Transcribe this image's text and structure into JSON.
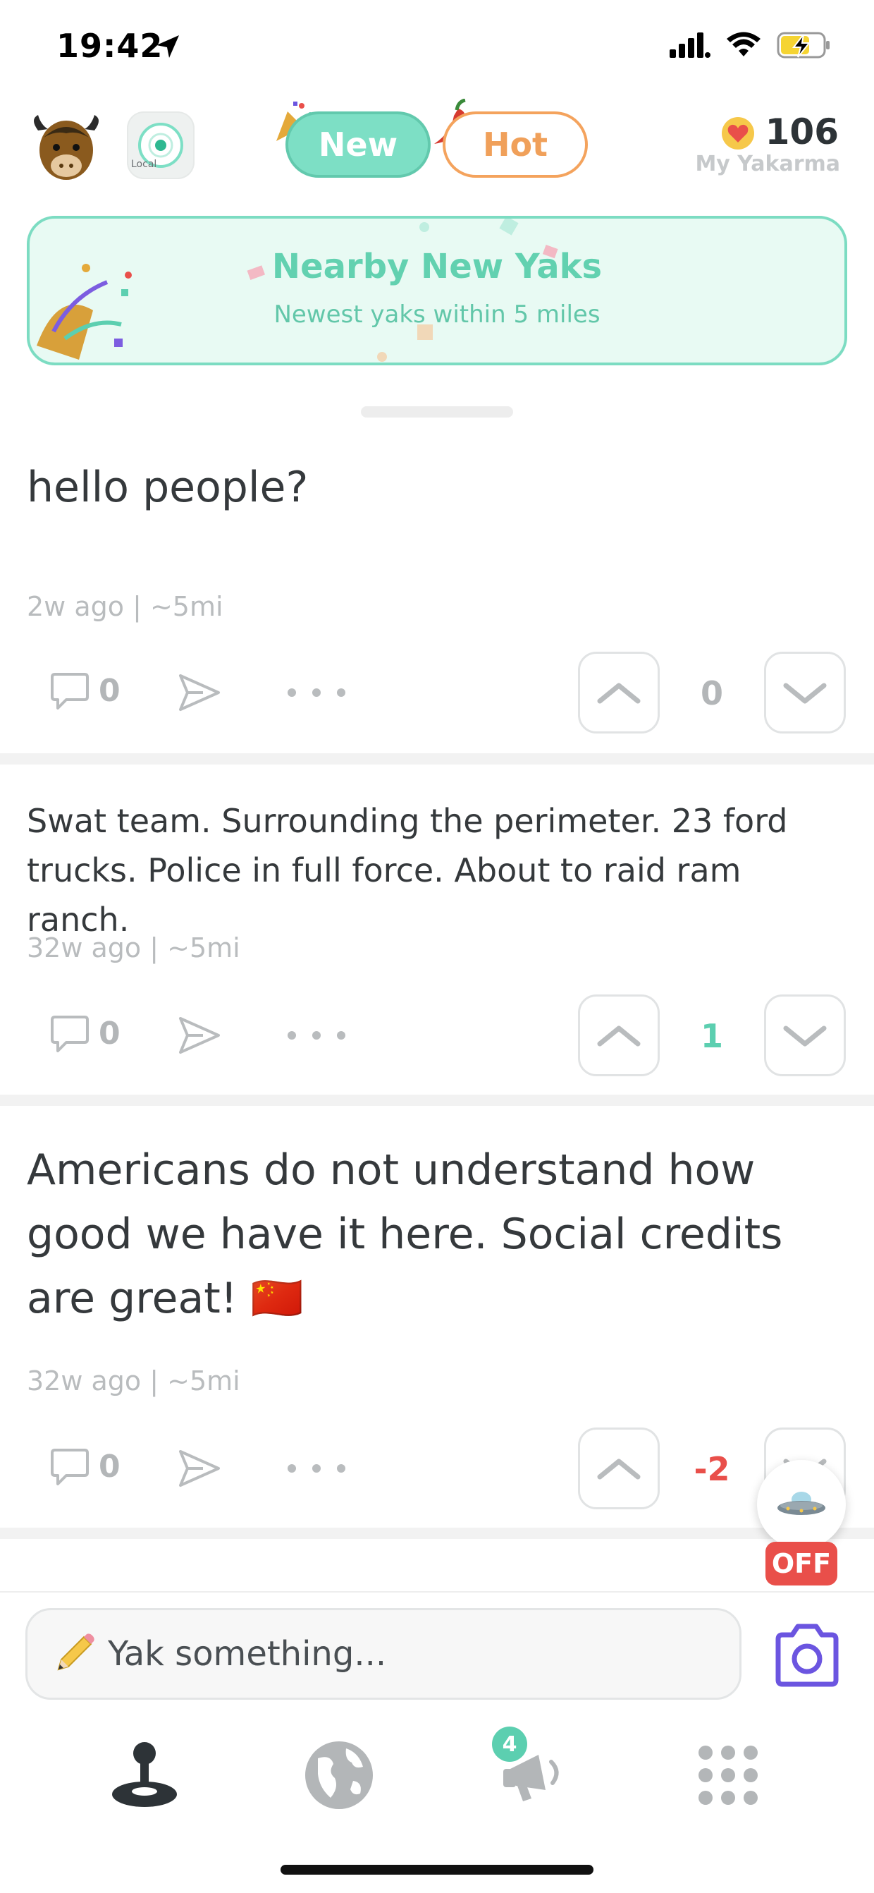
{
  "status_bar": {
    "time": "19:42"
  },
  "header": {
    "avatar_icon": "yak-avatar-icon",
    "local_label": "Local",
    "tabs": [
      {
        "label": "New",
        "active": true
      },
      {
        "label": "Hot",
        "active": false
      }
    ],
    "karma": {
      "value": "106",
      "label": "My Yakarma"
    }
  },
  "banner": {
    "title": "Nearby New Yaks",
    "subtitle": "Newest yaks within 5 miles"
  },
  "posts": [
    {
      "text": "hello people?",
      "meta": "2w ago | ~5mi",
      "comments": "0",
      "score": "0",
      "score_color": "#b3b6b8"
    },
    {
      "text": "Swat team. Surrounding the perimeter. 23 ford trucks. Police in full force. About to raid ram ranch.",
      "meta": "32w ago | ~5mi",
      "comments": "0",
      "score": "1",
      "score_color": "#5ccfb0"
    },
    {
      "text": "Americans do not understand how good we have it here. Social credits are great! 🇨🇳",
      "meta": "32w ago | ~5mi",
      "comments": "0",
      "score": "-2",
      "score_color": "#e94f4a"
    }
  ],
  "floating": {
    "ufo_icon": "ufo-icon",
    "off_label": "OFF"
  },
  "composer": {
    "placeholder": "Yak something..."
  },
  "bottom_nav": {
    "items": [
      "local-feed-icon",
      "globe-icon",
      "megaphone-icon",
      "apps-grid-icon"
    ],
    "notification_count": "4"
  },
  "colors": {
    "accent": "#7ddfc5",
    "hot": "#f4a35d",
    "negative": "#e94f4a",
    "camera": "#6b55e0"
  }
}
